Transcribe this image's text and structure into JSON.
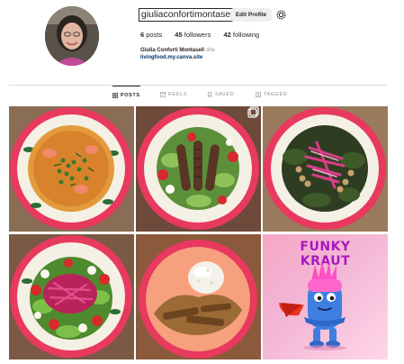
{
  "profile": {
    "username": "giuliaconfortimontasell",
    "edit_button": "Edit Profile",
    "stats": [
      {
        "count": "6",
        "label": "posts"
      },
      {
        "count": "45",
        "label": "followers"
      },
      {
        "count": "42",
        "label": "following"
      }
    ],
    "full_name": "Giulia Conforti Montasell",
    "pronouns": "she",
    "link": "livingfood.my.canva.site"
  },
  "tabs": [
    {
      "label": "POSTS",
      "icon": "grid-icon",
      "active": true
    },
    {
      "label": "REELS",
      "icon": "reels-icon",
      "active": false
    },
    {
      "label": "SAVED",
      "icon": "bookmark-icon",
      "active": false
    },
    {
      "label": "TAGGED",
      "icon": "tagged-icon",
      "active": false
    }
  ],
  "posts": [
    {
      "kind": "curry-soup-with-peas"
    },
    {
      "kind": "grilled-sausages-salad",
      "multi_photo": true
    },
    {
      "kind": "kale-red-cabbage-chickpeas"
    },
    {
      "kind": "red-cabbage-greens-tomatoes"
    },
    {
      "kind": "rice-with-stew"
    },
    {
      "kind": "funky-kraut-poster",
      "title_line1": "FUNKY",
      "title_line2": "KRAUT"
    }
  ],
  "colors": {
    "link": "#00376b",
    "plate_rim": "#e8395f",
    "poster_title": "#a818c0",
    "poster_bg": "#f6a6c6",
    "character_blue": "#3f7fe0",
    "character_hair": "#ff4fc4"
  }
}
